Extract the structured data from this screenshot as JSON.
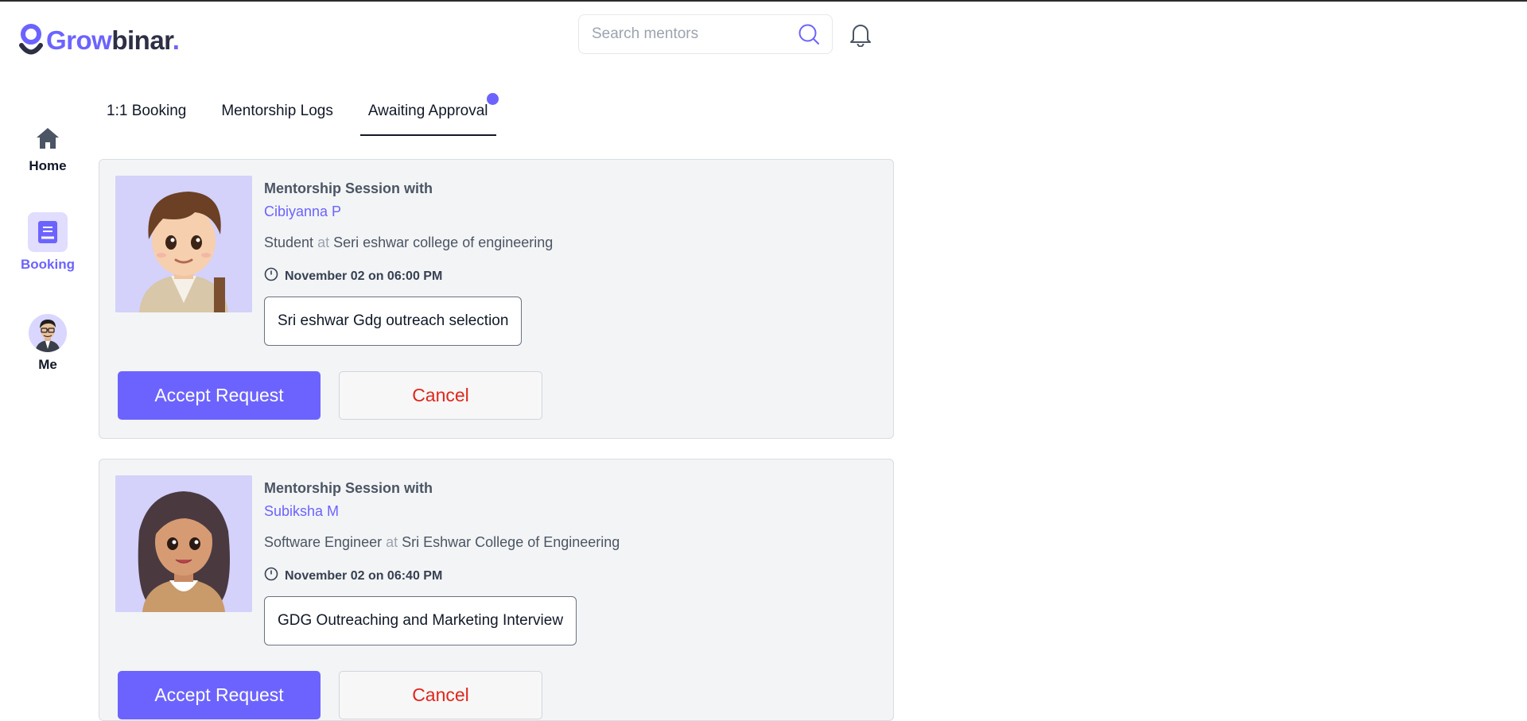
{
  "brand": {
    "grow": "Grow",
    "binar": "binar",
    "dot": "."
  },
  "header": {
    "search_placeholder": "Search mentors",
    "icons": {
      "search": "search-icon",
      "notifications": "bell-icon"
    }
  },
  "sidebar": {
    "items": [
      {
        "label": "Home",
        "icon": "home-icon"
      },
      {
        "label": "Booking",
        "icon": "book-icon",
        "active": true
      },
      {
        "label": "Me",
        "icon": "avatar"
      }
    ]
  },
  "tabs": [
    {
      "label": "1:1 Booking"
    },
    {
      "label": "Mentorship Logs"
    },
    {
      "label": "Awaiting Approval",
      "active": true,
      "has_notification_dot": true
    }
  ],
  "requests": [
    {
      "session_label": "Mentorship Session with",
      "name": "Cibiyanna P",
      "role": "Student",
      "at": "at",
      "org": "Seri eshwar college of engineering",
      "time": "November 02 on 06:00 PM",
      "topic": "Sri eshwar Gdg outreach selection",
      "accept_label": "Accept Request",
      "cancel_label": "Cancel"
    },
    {
      "session_label": "Mentorship Session with",
      "name": "Subiksha M",
      "role": "Software Engineer",
      "at": "at",
      "org": "Sri Eshwar College of Engineering",
      "time": "November 02 on 06:40 PM",
      "topic": "GDG Outreaching and Marketing Interview",
      "accept_label": "Accept Request",
      "cancel_label": "Cancel"
    }
  ],
  "colors": {
    "accent": "#6c63ff",
    "cancel": "#e0261c",
    "card_bg": "#f3f4f6"
  }
}
